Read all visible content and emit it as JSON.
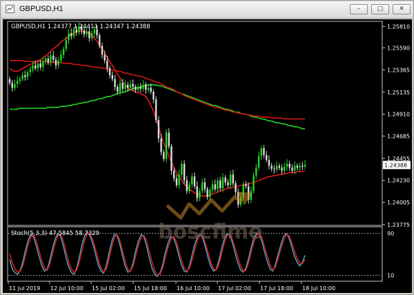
{
  "window": {
    "title": "GBPUSD,H1",
    "buttons": {
      "minimize": "–",
      "restore": "□",
      "close": "✕"
    },
    "icon": "chart-window-icon"
  },
  "chart_data": [
    {
      "type": "candlestick",
      "title": "GBPUSD,H1",
      "ohlc_label": "GBPUSD,H1  1.24377  1.24411  1.24347  1.24388",
      "ylim": [
        1.23775,
        1.25855
      ],
      "ticks": [
        "1.25810",
        "1.25590",
        "1.25365",
        "1.25135",
        "1.24910",
        "1.24685",
        "1.24455",
        "1.24230",
        "1.24005",
        "1.23775"
      ],
      "current_price": "1.24388",
      "colors": {
        "up": "#22dd22",
        "down": "#dddddd",
        "ma_fast": "#e01a1a",
        "ma_mid": "#d51515",
        "ma_slow": "#22d622",
        "price_box": "#ffffff"
      },
      "x_labels": [
        "11 Jul 2019",
        "12 Jul 10:00",
        "15 Jul 02:00",
        "15 Jul 18:00",
        "16 Jul 10:00",
        "17 Jul 02:00",
        "17 Jul 18:00",
        "18 Jul 10:00"
      ],
      "closes": [
        1.2523,
        1.2518,
        1.2522,
        1.2525,
        1.2527,
        1.2531,
        1.2529,
        1.2534,
        1.2537,
        1.2541,
        1.2538,
        1.2543,
        1.2539,
        1.2545,
        1.2548,
        1.2544,
        1.2551,
        1.2547,
        1.2541,
        1.2546,
        1.2552,
        1.2558,
        1.2567,
        1.2574,
        1.2571,
        1.2578,
        1.2575,
        1.2581,
        1.2577,
        1.2573,
        1.2576,
        1.2569,
        1.2574,
        1.2578,
        1.2572,
        1.2561,
        1.2552,
        1.2546,
        1.2538,
        1.2531,
        1.2527,
        1.2519,
        1.2514,
        1.2523,
        1.2517,
        1.2521,
        1.2518,
        1.2522,
        1.2519,
        1.2516,
        1.2519,
        1.2517,
        1.2521,
        1.2516,
        1.2518,
        1.2514,
        1.2506,
        1.2485,
        1.2466,
        1.2452,
        1.2445,
        1.2472,
        1.2458,
        1.2433,
        1.2425,
        1.2418,
        1.2429,
        1.244,
        1.2423,
        1.2412,
        1.2419,
        1.2427,
        1.2417,
        1.2405,
        1.2412,
        1.2421,
        1.2414,
        1.2406,
        1.2413,
        1.2419,
        1.2414,
        1.2423,
        1.2415,
        1.2426,
        1.2421,
        1.2418,
        1.2429,
        1.242,
        1.2411,
        1.2398,
        1.2406,
        1.2419,
        1.2417,
        1.2403,
        1.2412,
        1.2428,
        1.2436,
        1.2448,
        1.2456,
        1.2449,
        1.2444,
        1.2438,
        1.2435,
        1.2434,
        1.2438,
        1.2436,
        1.2433,
        1.2437,
        1.244,
        1.2436,
        1.2433,
        1.2438,
        1.2436,
        1.2438,
        1.2437,
        1.2439
      ],
      "ma_fast": [
        1.2538,
        1.2536,
        1.2535,
        1.2535,
        1.2536,
        1.2538,
        1.2539,
        1.2541,
        1.2542,
        1.2543,
        1.2544,
        1.2546,
        1.2547,
        1.2549,
        1.2551,
        1.2553,
        1.2556,
        1.2558,
        1.256,
        1.2562,
        1.2565,
        1.2567,
        1.2569,
        1.2571,
        1.2573,
        1.2574,
        1.2575,
        1.2576,
        1.2576,
        1.2576,
        1.2575,
        1.2574,
        1.2572,
        1.2569,
        1.2566,
        1.2562,
        1.2558,
        1.2554,
        1.2549,
        1.2545,
        1.2541,
        1.2536,
        1.2532,
        1.2528,
        1.2524,
        1.2521,
        1.2518,
        1.2516,
        1.2515,
        1.2514,
        1.2513,
        1.2512,
        1.2511,
        1.2509,
        1.2505,
        1.25,
        1.2494,
        1.2486,
        1.2478,
        1.2469,
        1.2461,
        1.2455,
        1.2448,
        1.2442,
        1.2436,
        1.2431,
        1.2427,
        1.2423,
        1.2419,
        1.2416,
        1.2414,
        1.2412,
        1.241,
        1.2409,
        1.2408,
        1.2407,
        1.2407,
        1.2407,
        1.2408,
        1.2409,
        1.241,
        1.2411,
        1.2412,
        1.2413,
        1.2414,
        1.2415,
        1.2415,
        1.2416,
        1.2416,
        1.2417,
        1.2418,
        1.2418,
        1.2419,
        1.2419,
        1.242,
        1.2421,
        1.2422,
        1.2423,
        1.2424,
        1.2425,
        1.2426,
        1.2427,
        1.2427,
        1.2428,
        1.2428,
        1.2429,
        1.2429,
        1.243,
        1.243,
        1.2431,
        1.2431,
        1.2431,
        1.2432,
        1.2432,
        1.2432,
        1.2433
      ],
      "ma_mid": [
        1.2546,
        1.2546,
        1.2546,
        1.2546,
        1.2546,
        1.2546,
        1.2545,
        1.2545,
        1.2545,
        1.2545,
        1.2545,
        1.2545,
        1.2545,
        1.2545,
        1.2545,
        1.2544,
        1.2544,
        1.2544,
        1.2544,
        1.2544,
        1.2544,
        1.2543,
        1.2543,
        1.2543,
        1.2543,
        1.2542,
        1.2542,
        1.2542,
        1.2541,
        1.2541,
        1.2541,
        1.254,
        1.254,
        1.2539,
        1.2539,
        1.2539,
        1.2538,
        1.2538,
        1.2537,
        1.2537,
        1.2536,
        1.2536,
        1.2535,
        1.2535,
        1.2534,
        1.2533,
        1.2533,
        1.2532,
        1.2531,
        1.2531,
        1.253,
        1.253,
        1.2529,
        1.2528,
        1.2527,
        1.2526,
        1.2525,
        1.2524,
        1.2523,
        1.2522,
        1.2521,
        1.2519,
        1.2518,
        1.2517,
        1.2516,
        1.2514,
        1.2513,
        1.2512,
        1.251,
        1.2509,
        1.2508,
        1.2507,
        1.2506,
        1.2505,
        1.2504,
        1.2503,
        1.2502,
        1.2501,
        1.25,
        1.2499,
        1.2498,
        1.2498,
        1.2497,
        1.2496,
        1.2495,
        1.2495,
        1.2494,
        1.2493,
        1.2493,
        1.2492,
        1.2492,
        1.2491,
        1.2491,
        1.249,
        1.249,
        1.2489,
        1.2489,
        1.2489,
        1.2488,
        1.2488,
        1.2488,
        1.2488,
        1.2487,
        1.2487,
        1.2487,
        1.2487,
        1.2487,
        1.2486,
        1.2486,
        1.2486,
        1.2486,
        1.2486,
        1.2486,
        1.2486,
        1.2486,
        1.2486
      ],
      "ma_slow": [
        1.2496,
        1.2496,
        1.2496,
        1.2496,
        1.2497,
        1.2497,
        1.2497,
        1.2497,
        1.2497,
        1.2497,
        1.2497,
        1.2497,
        1.2497,
        1.2497,
        1.2497,
        1.2498,
        1.2498,
        1.2498,
        1.2498,
        1.2498,
        1.2499,
        1.2499,
        1.2499,
        1.25,
        1.25,
        1.2501,
        1.2501,
        1.2502,
        1.2502,
        1.2503,
        1.2503,
        1.2504,
        1.2505,
        1.2505,
        1.2506,
        1.2507,
        1.2507,
        1.2508,
        1.2509,
        1.2509,
        1.251,
        1.2511,
        1.2512,
        1.2513,
        1.2513,
        1.2514,
        1.2515,
        1.2516,
        1.2517,
        1.2518,
        1.2518,
        1.2519,
        1.252,
        1.2521,
        1.2521,
        1.2521,
        1.2521,
        1.2521,
        1.252,
        1.252,
        1.2519,
        1.2518,
        1.2517,
        1.2516,
        1.2515,
        1.2514,
        1.2513,
        1.2512,
        1.2511,
        1.251,
        1.2509,
        1.2508,
        1.2507,
        1.2506,
        1.2505,
        1.2504,
        1.2503,
        1.2502,
        1.2501,
        1.25,
        1.25,
        1.2499,
        1.2498,
        1.2497,
        1.2496,
        1.2496,
        1.2495,
        1.2494,
        1.2493,
        1.2493,
        1.2492,
        1.2491,
        1.2491,
        1.249,
        1.2489,
        1.2488,
        1.2488,
        1.2487,
        1.2486,
        1.2486,
        1.2485,
        1.2484,
        1.2484,
        1.2483,
        1.2482,
        1.2482,
        1.2481,
        1.2481,
        1.248,
        1.2479,
        1.2479,
        1.2478,
        1.2478,
        1.2477,
        1.2476,
        1.2476
      ]
    },
    {
      "type": "line",
      "title": "Stoch(5,3,3) 47.5845 58.7329",
      "ylim": [
        0,
        100
      ],
      "ticks": [
        "90",
        "10"
      ],
      "levels": [
        90,
        10
      ],
      "series": [
        {
          "color": "#4fa8c8",
          "values": [
            40,
            22,
            15,
            12,
            20,
            38,
            60,
            78,
            88,
            82,
            65,
            45,
            28,
            18,
            22,
            40,
            62,
            80,
            90,
            84,
            66,
            44,
            26,
            15,
            12,
            24,
            46,
            70,
            86,
            92,
            85,
            70,
            50,
            30,
            18,
            14,
            28,
            52,
            74,
            88,
            86,
            70,
            48,
            28,
            16,
            18,
            34,
            58,
            76,
            88,
            84,
            66,
            44,
            24,
            12,
            8,
            14,
            30,
            54,
            72,
            84,
            82,
            68,
            48,
            30,
            18,
            16,
            28,
            50,
            70,
            84,
            88,
            80,
            62,
            42,
            26,
            18,
            22,
            40,
            62,
            80,
            90,
            86,
            72,
            52,
            34,
            20,
            16,
            24,
            42,
            64,
            82,
            90,
            88,
            74,
            54,
            36,
            22,
            18,
            30,
            50,
            68,
            84,
            90,
            82,
            66,
            48,
            36,
            28,
            34,
            48
          ]
        },
        {
          "color": "#e01a1a",
          "values": [
            52,
            34,
            22,
            16,
            18,
            30,
            50,
            70,
            84,
            86,
            74,
            56,
            38,
            24,
            20,
            32,
            52,
            72,
            86,
            88,
            76,
            56,
            36,
            22,
            15,
            20,
            36,
            58,
            78,
            90,
            88,
            78,
            60,
            40,
            24,
            16,
            22,
            42,
            64,
            82,
            88,
            78,
            58,
            38,
            22,
            18,
            28,
            48,
            68,
            82,
            86,
            76,
            56,
            36,
            20,
            10,
            12,
            24,
            44,
            64,
            78,
            84,
            76,
            58,
            40,
            24,
            18,
            24,
            40,
            60,
            78,
            86,
            84,
            70,
            52,
            34,
            22,
            20,
            32,
            52,
            72,
            86,
            88,
            78,
            62,
            44,
            28,
            18,
            20,
            34,
            54,
            74,
            86,
            90,
            82,
            64,
            46,
            30,
            20,
            26,
            42,
            60,
            76,
            88,
            86,
            74,
            58,
            44,
            34,
            32,
            40
          ]
        }
      ]
    }
  ],
  "watermark": {
    "text": "boscfime"
  }
}
